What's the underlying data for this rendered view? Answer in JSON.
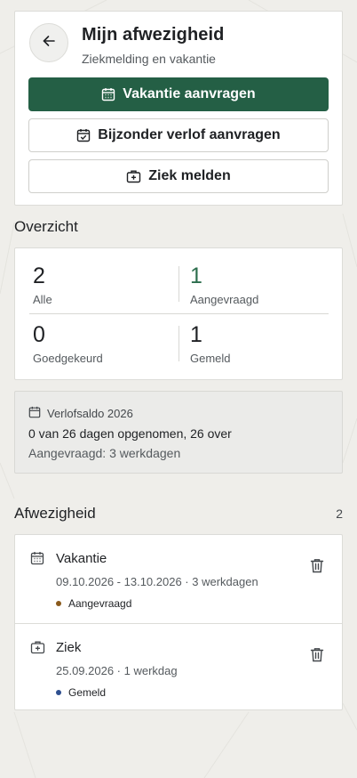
{
  "header": {
    "title": "Mijn afwezigheid",
    "subtitle": "Ziekmelding en vakantie",
    "back_icon": "arrow-left-icon"
  },
  "actions": {
    "vacation_label": "Vakantie aanvragen",
    "leave_label": "Bijzonder verlof aanvragen",
    "sick_label": "Ziek melden"
  },
  "overview": {
    "title": "Overzicht",
    "stats": [
      {
        "value": "2",
        "label": "Alle"
      },
      {
        "value": "1",
        "label": "Aangevraagd"
      },
      {
        "value": "0",
        "label": "Goedgekeurd"
      },
      {
        "value": "1",
        "label": "Gemeld"
      }
    ]
  },
  "balance": {
    "title": "Verlofsaldo 2026",
    "main": "0 van 26 dagen opgenomen, 26 over",
    "requested": "Aangevraagd: 3 werkdagen"
  },
  "absences": {
    "title": "Afwezigheid",
    "count": "2",
    "items": [
      {
        "title": "Vakantie",
        "dates": "09.10.2026 - 13.10.2026 · 3 werkdagen",
        "status": "Aangevraagd",
        "status_color": "#8a5a1c",
        "icon": "calendar-icon"
      },
      {
        "title": "Ziek",
        "dates": "25.09.2026 · 1 werkdag",
        "status": "Gemeld",
        "status_color": "#2e4f8f",
        "icon": "medical-case-icon"
      }
    ]
  },
  "colors": {
    "primary": "#245f45",
    "accent_number": "#2c6e4d",
    "background": "#efeeea"
  }
}
